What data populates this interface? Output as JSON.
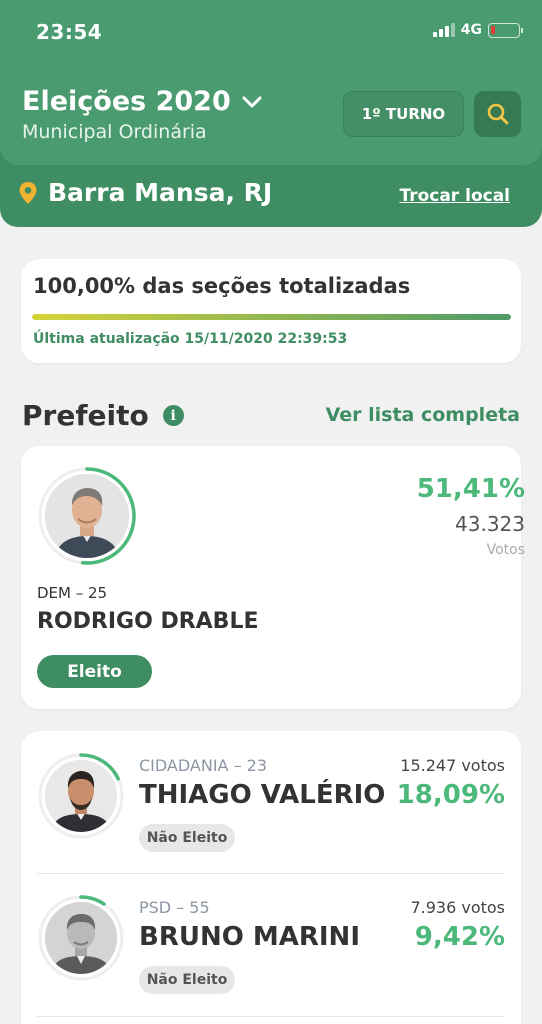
{
  "status_bar": {
    "time": "23:54",
    "network": "4G",
    "battery_level": 0.15
  },
  "header": {
    "title": "Eleições 2020",
    "subtitle": "Municipal Ordinária",
    "turno_label": "1º TURNO",
    "location": "Barra Mansa, RJ",
    "change_location_label": "Trocar local"
  },
  "progress": {
    "title": "100,00% das seções totalizadas",
    "level": 1.0,
    "updated": "Última atualização 15/11/2020 22:39:53"
  },
  "section": {
    "title": "Prefeito",
    "see_all_label": "Ver lista completa"
  },
  "winner": {
    "party": "DEM – 25",
    "name": "RODRIGO DRABLE",
    "percent": "51,41%",
    "votes": "43.323",
    "votes_label": "Votos",
    "status": "Eleito",
    "share": 0.5141
  },
  "candidates": [
    {
      "party": "CIDADANIA – 23",
      "name": "THIAGO VALÉRIO",
      "votes": "15.247 votos",
      "percent": "18,09%",
      "status": "Não Eleito",
      "share": 0.1809
    },
    {
      "party": "PSD – 55",
      "name": "BRUNO MARINI",
      "votes": "7.936 votos",
      "percent": "9,42%",
      "status": "Não Eleito",
      "share": 0.0942
    }
  ],
  "colors": {
    "header_green": "#4a9b70",
    "accent_green": "#3f8d63",
    "percent_green": "#4cb87a",
    "pin_yellow": "#f2b233",
    "search_yellow": "#f5c542"
  }
}
